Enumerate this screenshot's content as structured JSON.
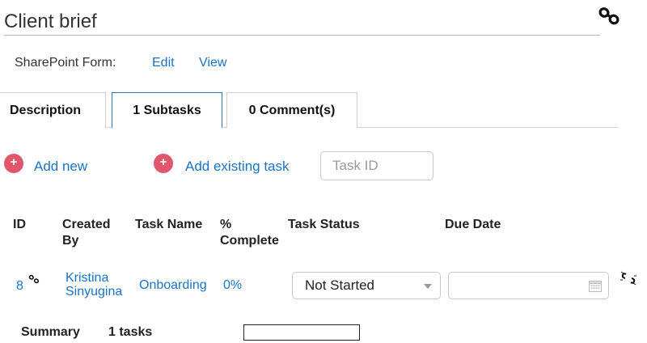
{
  "header": {
    "title": "Client brief",
    "link_icon": "link-icon"
  },
  "sharepoint": {
    "label": "SharePoint Form:",
    "edit": "Edit",
    "view": "View"
  },
  "tabs": [
    {
      "label": "Description",
      "active": false
    },
    {
      "label": "1 Subtasks",
      "active": true
    },
    {
      "label": "0 Comment(s)",
      "active": false
    }
  ],
  "actions": {
    "plus_symbol": "+",
    "add_new": "Add new",
    "add_existing": "Add existing task",
    "task_id_placeholder": "Task ID"
  },
  "table": {
    "headers": {
      "id": "ID",
      "created_by": "Created By",
      "task_name": "Task Name",
      "percent": "% Complete",
      "status": "Task Status",
      "due": "Due Date"
    },
    "rows": [
      {
        "id": "8",
        "created_by": "Kristina Sinyugina",
        "task_name": "Onboarding",
        "percent": "0%",
        "status": "Not Started",
        "due": ""
      }
    ]
  },
  "summary": {
    "label": "Summary",
    "count": "1 tasks",
    "progress": 0
  },
  "colors": {
    "accent": "#1a73c5",
    "plus": "#e0576b",
    "active_tab_border": "#2b73c8"
  }
}
